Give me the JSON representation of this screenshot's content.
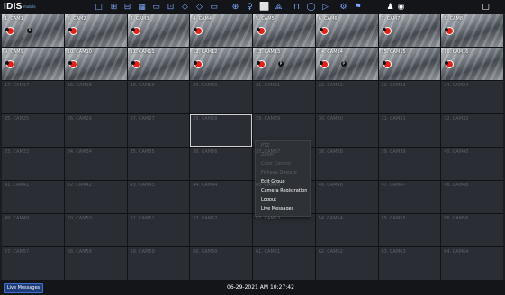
{
  "app": {
    "logo": "IDIS",
    "logo_sub": "mobile"
  },
  "toolbar": {
    "icons": [
      "layout-1x1-icon",
      "layout-2x2-icon",
      "layout-3x3-icon",
      "layout-4x4-icon",
      "layout-custom-icon",
      "sequence-icon",
      "prev-icon",
      "next-icon",
      "fullscreen-icon",
      "record-icon",
      "alarm-icon",
      "copy-icon",
      "ptz-icon",
      "camera-icon",
      "search-icon",
      "play-icon",
      "settings-icon",
      "tools-icon",
      "user-icon",
      "globe-icon",
      "window-icon"
    ]
  },
  "cameras": [
    {
      "label": "1. CAM1",
      "active": true,
      "rec": true,
      "p": true
    },
    {
      "label": "2. CAM2",
      "active": true,
      "rec": true,
      "p": false
    },
    {
      "label": "3. CAM3",
      "active": true,
      "rec": true,
      "p": false
    },
    {
      "label": "4. CAM4",
      "active": true,
      "rec": true,
      "p": false
    },
    {
      "label": "5. CAM5",
      "active": true,
      "rec": true,
      "p": false
    },
    {
      "label": "6. CAM6",
      "active": true,
      "rec": true,
      "p": false
    },
    {
      "label": "7. CAM7",
      "active": true,
      "rec": true,
      "p": false
    },
    {
      "label": "8. CAM8",
      "active": true,
      "rec": true,
      "p": false
    },
    {
      "label": "9. CAM9",
      "active": true,
      "rec": true,
      "p": false
    },
    {
      "label": "10. CAM10",
      "active": true,
      "rec": true,
      "p": false
    },
    {
      "label": "11. CAM11",
      "active": true,
      "rec": true,
      "p": false
    },
    {
      "label": "12. CAM12",
      "active": true,
      "rec": true,
      "p": false
    },
    {
      "label": "13. CAM13",
      "active": true,
      "rec": true,
      "p": true
    },
    {
      "label": "14. CAM14",
      "active": true,
      "rec": true,
      "p": true
    },
    {
      "label": "15. CAM15",
      "active": true,
      "rec": true,
      "p": false
    },
    {
      "label": "16. CAM16",
      "active": true,
      "rec": true,
      "p": false
    },
    {
      "label": "17. CAM17"
    },
    {
      "label": "18. CAM18"
    },
    {
      "label": "19. CAM19"
    },
    {
      "label": "20. CAM20"
    },
    {
      "label": "21. CAM21"
    },
    {
      "label": "22. CAM22"
    },
    {
      "label": "23. CAM23"
    },
    {
      "label": "24. CAM24"
    },
    {
      "label": "25. CAM25"
    },
    {
      "label": "26. CAM26"
    },
    {
      "label": "27. CAM27"
    },
    {
      "label": "28. CAM28",
      "selected": true
    },
    {
      "label": "29. CAM29"
    },
    {
      "label": "30. CAM30"
    },
    {
      "label": "31. CAM31"
    },
    {
      "label": "32. CAM32"
    },
    {
      "label": "33. CAM33"
    },
    {
      "label": "34. CAM34"
    },
    {
      "label": "35. CAM35"
    },
    {
      "label": "36. CAM36"
    },
    {
      "label": "37. CAM37"
    },
    {
      "label": "38. CAM38"
    },
    {
      "label": "39. CAM39"
    },
    {
      "label": "40. CAM40"
    },
    {
      "label": "41. CAM41"
    },
    {
      "label": "42. CAM42"
    },
    {
      "label": "43. CAM43"
    },
    {
      "label": "44. CAM44"
    },
    {
      "label": "45. CAM45"
    },
    {
      "label": "46. CAM46"
    },
    {
      "label": "47. CAM47"
    },
    {
      "label": "48. CAM48"
    },
    {
      "label": "49. CAM49"
    },
    {
      "label": "50. CAM50"
    },
    {
      "label": "51. CAM51"
    },
    {
      "label": "52. CAM52"
    },
    {
      "label": "53. CAM53"
    },
    {
      "label": "54. CAM54"
    },
    {
      "label": "55. CAM55"
    },
    {
      "label": "56. CAM56"
    },
    {
      "label": "57. CAM57"
    },
    {
      "label": "58. CAM58"
    },
    {
      "label": "59. CAM59"
    },
    {
      "label": "60. CAM60"
    },
    {
      "label": "61. CAM61"
    },
    {
      "label": "62. CAM62"
    },
    {
      "label": "63. CAM63"
    },
    {
      "label": "64. CAM64"
    }
  ],
  "context_menu": {
    "items": [
      {
        "label": "PTZ",
        "enabled": false
      },
      {
        "label": "Zoom",
        "enabled": false
      },
      {
        "label": "Color Control",
        "enabled": false
      },
      {
        "label": "Fisheye Dewarp",
        "enabled": false
      },
      {
        "label": "Edit Group",
        "enabled": true
      },
      {
        "label": "Camera Registration",
        "enabled": true
      },
      {
        "label": "Logout",
        "enabled": true
      },
      {
        "label": "Live Messages",
        "enabled": true
      }
    ]
  },
  "status": {
    "live_messages_button": "Live Messages",
    "datetime": "06-29-2021  AM 10:27:42"
  },
  "colors": {
    "accent": "#3f6fc9",
    "rec": "#e0231a",
    "background": "#1b1d22"
  }
}
